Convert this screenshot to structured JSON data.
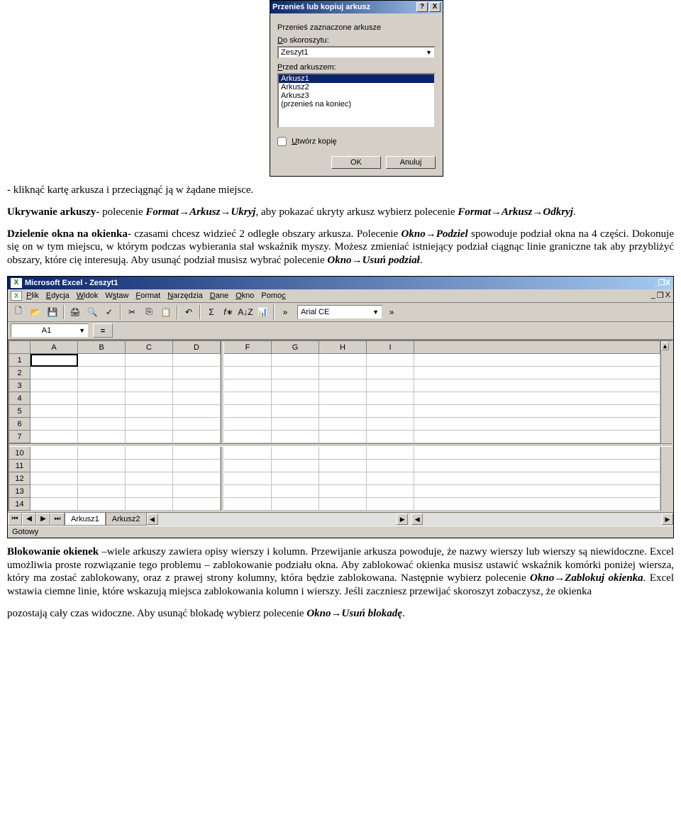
{
  "dialog": {
    "title": "Przenieś lub kopiuj arkusz",
    "subtitle": "Przenieś zaznaczone arkusze",
    "to_workbook_label": "Do skoroszytu:",
    "workbook_value": "Zeszyt1",
    "before_sheet_label": "Przed arkuszem:",
    "sheets": [
      "Arkusz1",
      "Arkusz2",
      "Arkusz3",
      "(przenieś na koniec)"
    ],
    "create_copy": "Utwórz kopię",
    "ok": "OK",
    "cancel": "Anuluj",
    "help": "?",
    "close": "X"
  },
  "para1": "- kliknąć kartę arkusza i przeciągnąć ją w żądane miejsce.",
  "para2_a": "Ukrywanie arkuszy",
  "para2_b": "- polecenie ",
  "para2_c": "Format",
  "para2_d": "Arkusz",
  "para2_e": "Ukryj",
  "para2_f": ", aby pokazać ukryty arkusz wybierz polecenie ",
  "para2_g": "Format",
  "para2_h": "Arkusz",
  "para2_i": "Odkryj",
  "para2_j": ".",
  "para3_a": "Dzielenie okna na okienka",
  "para3_b": "- czasami chcesz widzieć 2 odległe obszary arkusza. Polecenie ",
  "para3_c": "Okno",
  "para3_d": "Podziel",
  "para3_e": " spowoduje podział okna na 4 części. Dokonuje się on w tym miejscu, w którym podczas wybierania stał wskaźnik myszy. Możesz zmieniać istniejący podział ciągnąc linie graniczne tak aby przybliżyć obszary, które cię interesują. Aby usunąć podział musisz wybrać polecenie ",
  "para3_f": "Okno",
  "para3_g": "Usuń podział",
  "para3_h": ".",
  "excel": {
    "title": "Microsoft Excel - Zeszyt1",
    "menus": [
      "Plik",
      "Edycja",
      "Widok",
      "Wstaw",
      "Format",
      "Narzędzia",
      "Dane",
      "Okno",
      "Pomoc"
    ],
    "namebox": "A1",
    "font": "Arial CE",
    "columns_left": [
      "A",
      "B",
      "C",
      "D"
    ],
    "columns_right": [
      "F",
      "G",
      "H",
      "I"
    ],
    "rows_top": [
      "1",
      "2",
      "3",
      "4",
      "5",
      "6",
      "7"
    ],
    "rows_bottom": [
      "10",
      "11",
      "12",
      "13",
      "14"
    ],
    "tabs": [
      "Arkusz1",
      "Arkusz2"
    ],
    "status": "Gotowy"
  },
  "para4_a": "Blokowanie okienek ",
  "para4_b": "–wiele arkuszy zawiera opisy wierszy i kolumn. Przewijanie arkusza powoduje, że nazwy wierszy lub wierszy są niewidoczne. Excel umożliwia proste rozwiązanie tego problemu – zablokowanie podziału okna. Aby zablokować okienka musisz ustawić wskaźnik komórki poniżej wiersza, który ma zostać zablokowany, oraz z prawej strony kolumny, która będzie zablokowana. Następnie wybierz polecenie ",
  "para4_c": "Okno",
  "para4_d": "Zablokuj okienka",
  "para4_e": ". Excel wstawia ciemne linie, które wskazują miejsca zablokowania kolumn i wierszy. Jeśli zaczniesz przewijać skoroszyt zobaczysz, że okienka",
  "para5_a": "pozostają cały czas widoczne. Aby usunąć blokadę wybierz polecenie ",
  "para5_b": "Okno",
  "para5_c": "Usuń blokadę",
  "para5_d": "."
}
